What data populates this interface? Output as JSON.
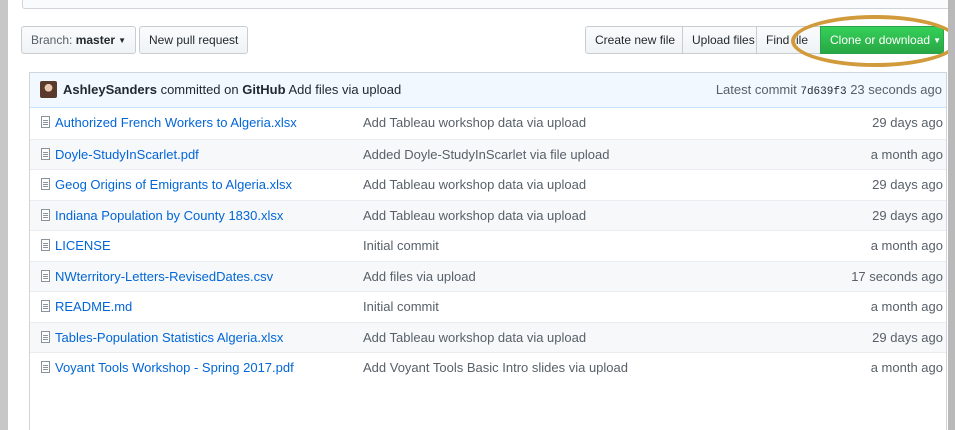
{
  "toolbar": {
    "branch_prefix": "Branch:",
    "branch_name": "master",
    "new_pull_request": "New pull request",
    "create_new_file": "Create new file",
    "upload_files": "Upload files",
    "find_file": "Find file",
    "clone_or_download": "Clone or download"
  },
  "commit": {
    "author": "AshleySanders",
    "action": "committed on",
    "platform": "GitHub",
    "message": "Add files via upload",
    "latest_label": "Latest commit",
    "sha": "7d639f3",
    "age": "23 seconds ago"
  },
  "files": [
    {
      "name": "Authorized French Workers to Algeria.xlsx",
      "message": "Add Tableau workshop data via upload",
      "age": "29 days ago"
    },
    {
      "name": "Doyle-StudyInScarlet.pdf",
      "message": "Added Doyle-StudyInScarlet via file upload",
      "age": "a month ago"
    },
    {
      "name": "Geog Origins of Emigrants to Algeria.xlsx",
      "message": "Add Tableau workshop data via upload",
      "age": "29 days ago"
    },
    {
      "name": "Indiana Population by County 1830.xlsx",
      "message": "Add Tableau workshop data via upload",
      "age": "29 days ago"
    },
    {
      "name": "LICENSE",
      "message": "Initial commit",
      "age": "a month ago"
    },
    {
      "name": "NWterritory-Letters-RevisedDates.csv",
      "message": "Add files via upload",
      "age": "17 seconds ago"
    },
    {
      "name": "README.md",
      "message": "Initial commit",
      "age": "a month ago"
    },
    {
      "name": "Tables-Population Statistics Algeria.xlsx",
      "message": "Add Tableau workshop data via upload",
      "age": "29 days ago"
    },
    {
      "name": "Voyant Tools Workshop - Spring 2017.pdf",
      "message": "Add Voyant Tools Basic Intro slides via upload",
      "age": "a month ago"
    }
  ],
  "colors": {
    "link": "#0366d6",
    "clone_button": "#28a745",
    "highlight_ring": "#d19a3a"
  }
}
